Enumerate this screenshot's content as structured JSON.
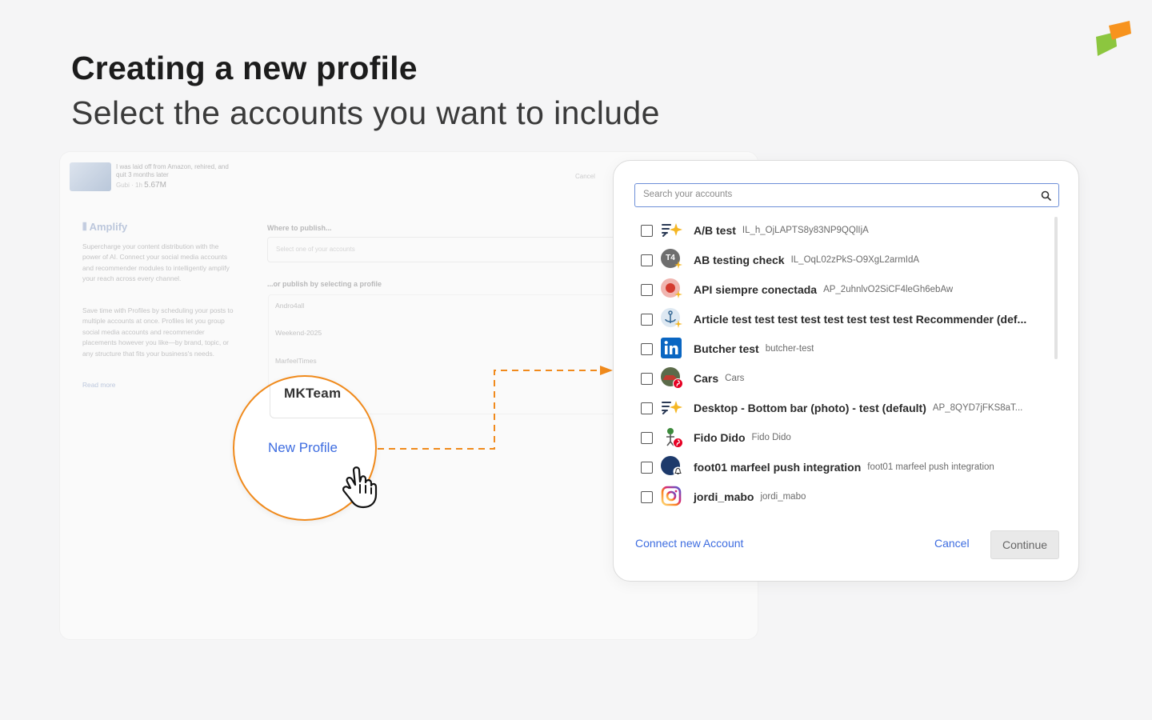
{
  "header": {
    "title": "Creating a new profile",
    "subtitle": "Select the accounts you want to include"
  },
  "background_app": {
    "video_title": "I was laid off from Amazon, rehired, and quit 3 months later",
    "video_channel": "Gubi · 1h",
    "video_views": "5.67M",
    "cancel_label": "Cancel",
    "brand": "Amplify",
    "description_1": "Supercharge your content distribution with the power of AI. Connect your social media accounts and recommender modules to intelligently amplify your reach across every channel.",
    "description_2": "Save time with Profiles by scheduling your posts to multiple accounts at once. Profiles let you group social media accounts and recommender placements however you like—by brand, topic, or any structure that fits your business's needs.",
    "read_more": "Read more",
    "where_label": "Where to publish...",
    "select_placeholder": "Select one of your accounts",
    "or_label": "...or publish by selecting a profile",
    "profiles": [
      "Andro4all",
      "Weekend-2025",
      "MarfeelTimes"
    ]
  },
  "magnifier": {
    "profile_name": "MKTeam",
    "new_profile_label": "New Profile"
  },
  "modal": {
    "search_placeholder": "Search your accounts",
    "accounts": [
      {
        "name": "A/B test",
        "id": "IL_h_OjLAPTS8y83NP9QQlIjA",
        "icon": "amplify-sparkle-icon"
      },
      {
        "name": "AB testing check",
        "id": "IL_OqL02zPkS-O9XgL2armIdA",
        "icon": "t4-avatar-icon"
      },
      {
        "name": "API siempre conectada",
        "id": "AP_2uhnlvO2SiCF4leGh6ebAw",
        "icon": "red-avatar-icon"
      },
      {
        "name": "Article test test test test test test test test Recommender (def...",
        "id": "",
        "icon": "anchor-avatar-icon"
      },
      {
        "name": "Butcher test",
        "id": "butcher-test",
        "icon": "linkedin-icon"
      },
      {
        "name": "Cars",
        "id": "Cars",
        "icon": "pinterest-car-avatar-icon"
      },
      {
        "name": "Desktop - Bottom bar (photo) - test (default)",
        "id": "AP_8QYD7jFKS8aT...",
        "icon": "amplify-sparkle-icon"
      },
      {
        "name": "Fido Dido",
        "id": "Fido Dido",
        "icon": "pinterest-character-avatar-icon"
      },
      {
        "name": "foot01 marfeel push integration",
        "id": "foot01 marfeel push integration",
        "icon": "push-notification-avatar-icon"
      },
      {
        "name": "jordi_mabo",
        "id": "jordi_mabo",
        "icon": "instagram-icon"
      }
    ],
    "connect_label": "Connect new Account",
    "cancel_label": "Cancel",
    "continue_label": "Continue"
  },
  "colors": {
    "accent_orange": "#f08a1c",
    "link_blue": "#3d6ce0"
  }
}
